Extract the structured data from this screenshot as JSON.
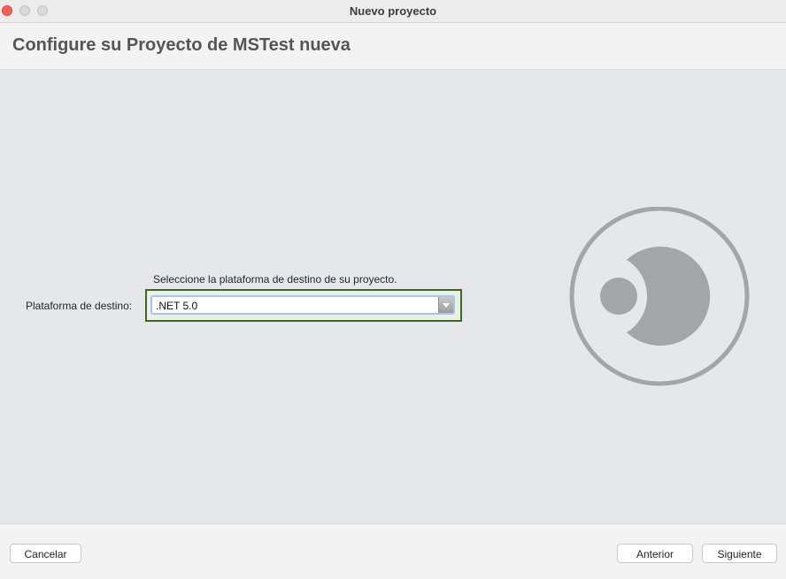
{
  "window": {
    "title": "Nuevo proyecto"
  },
  "header": {
    "title": "Configure su Proyecto de MSTest nueva"
  },
  "form": {
    "hint": "Seleccione la plataforma de destino de su proyecto.",
    "platform_label": "Plataforma de destino:",
    "platform_value": ".NET 5.0"
  },
  "footer": {
    "cancel_label": "Cancelar",
    "previous_label": "Anterior",
    "next_label": "Siguiente"
  },
  "colors": {
    "accent_focus": "#3b6a1e",
    "logo": "#a3a6a8"
  },
  "icons": {
    "logo": "project-template-logo-icon",
    "dropdown": "chevron-down-icon"
  }
}
